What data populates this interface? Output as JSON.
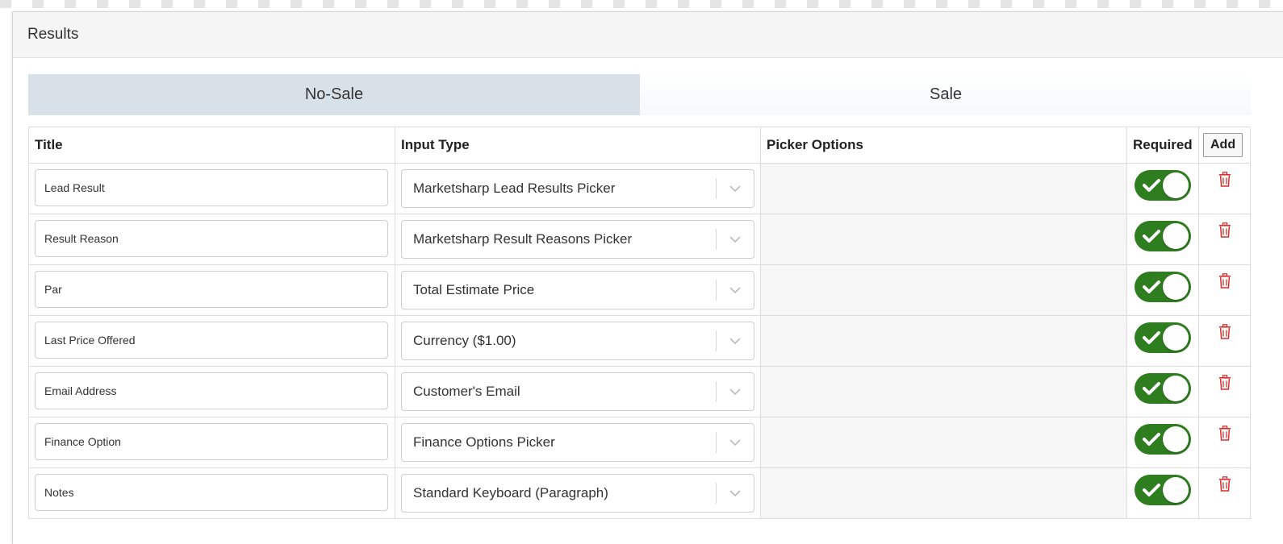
{
  "panel": {
    "title": "Results"
  },
  "tabs": [
    {
      "label": "No-Sale",
      "active": true
    },
    {
      "label": "Sale",
      "active": false
    }
  ],
  "table": {
    "headers": {
      "title": "Title",
      "input_type": "Input Type",
      "picker_options": "Picker Options",
      "required": "Required",
      "add": "Add"
    },
    "rows": [
      {
        "title": "Lead Result",
        "input_type": "Marketsharp Lead Results Picker",
        "required": true
      },
      {
        "title": "Result Reason",
        "input_type": "Marketsharp Result Reasons Picker",
        "required": true
      },
      {
        "title": "Par",
        "input_type": "Total Estimate Price",
        "required": true
      },
      {
        "title": "Last Price Offered",
        "input_type": "Currency ($1.00)",
        "required": true
      },
      {
        "title": "Email Address",
        "input_type": "Customer's Email",
        "required": true
      },
      {
        "title": "Finance Option",
        "input_type": "Finance Options Picker",
        "required": true
      },
      {
        "title": "Notes",
        "input_type": "Standard Keyboard (Paragraph)",
        "required": true
      }
    ]
  },
  "icons": {
    "toggle_check": "check-icon",
    "dropdown": "chevron-down-icon",
    "delete": "trash-icon"
  },
  "colors": {
    "toggle_on": "#2e7d1f",
    "trash": "#d9302c",
    "active_tab": "#d9e1e8"
  }
}
